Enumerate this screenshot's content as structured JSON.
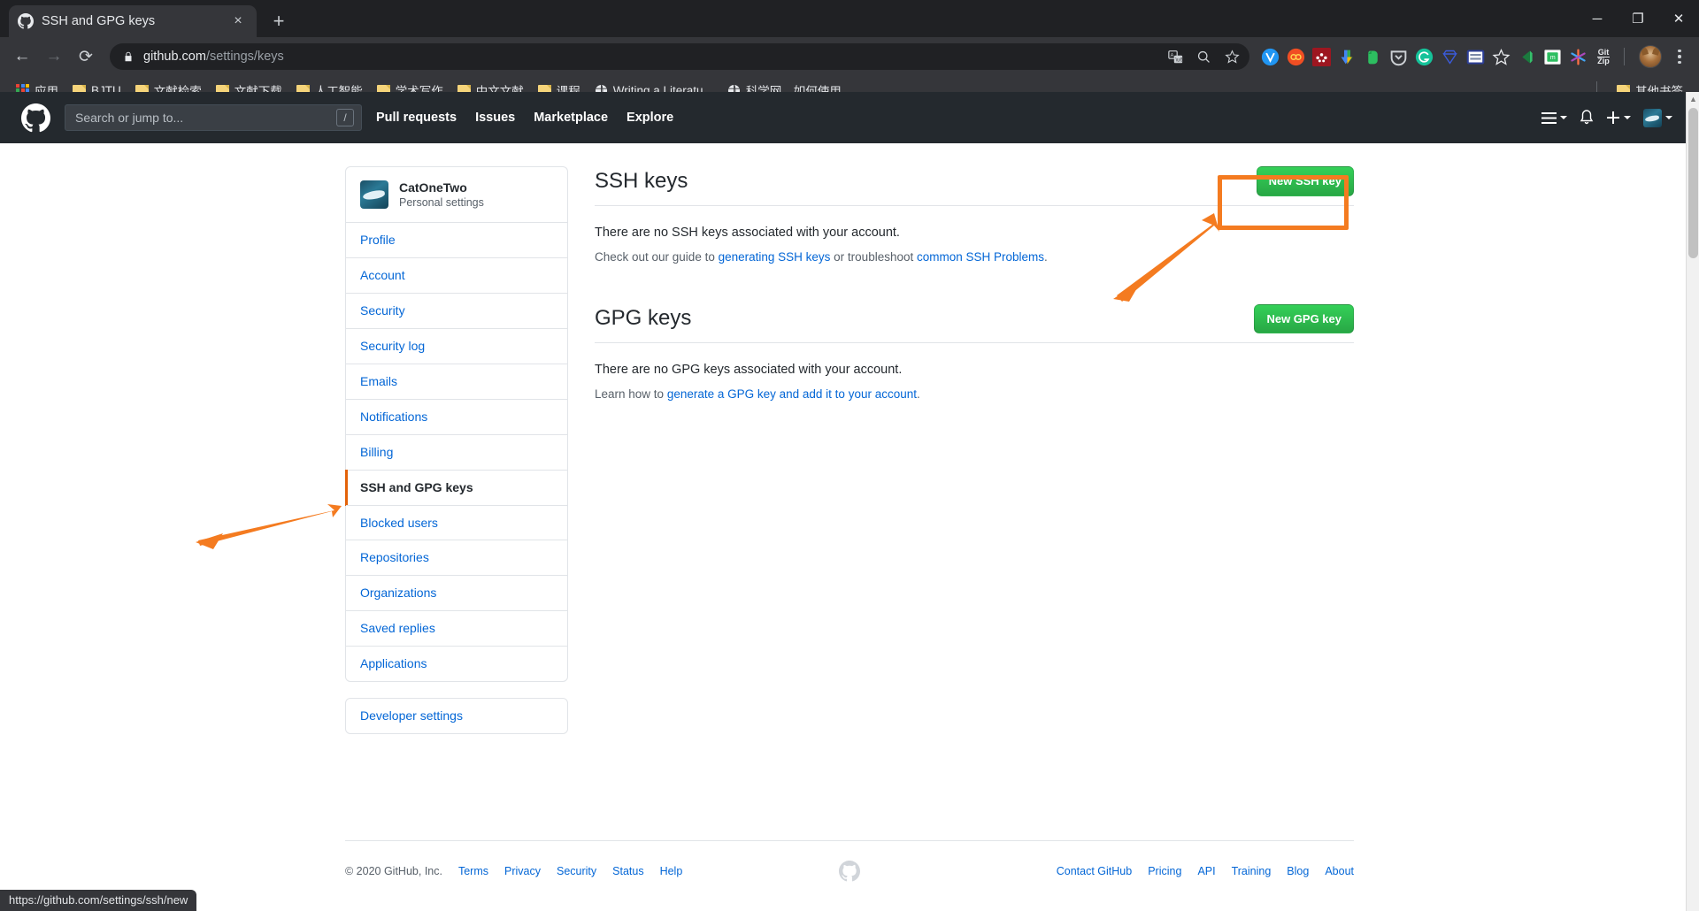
{
  "browser": {
    "tab": {
      "title": "SSH and GPG keys",
      "favicon": "github-icon",
      "close": "×"
    },
    "new_tab_label": "+",
    "window_controls": {
      "minimize": "─",
      "maximize": "❐",
      "close": "✕"
    },
    "nav": {
      "back": "←",
      "forward": "→",
      "reload": "⟳"
    },
    "omnibox": {
      "url_domain": "github.com",
      "url_path": "/settings/keys",
      "lock": "lock-icon"
    },
    "omnibox_icons": [
      "translate-icon",
      "search-icon",
      "bookmark-star-icon"
    ],
    "extensions": [
      "vimium-extension-icon",
      "infinity-extension-icon",
      "mendeley-extension-icon",
      "download-extension-icon",
      "evernote-extension-icon",
      "pocket-extension-icon",
      "grammarly-extension-icon",
      "diamond-extension-icon",
      "reader-extension-icon",
      "star-extension-icon",
      "green-triangle-extension-icon",
      "green-square-extension-icon",
      "asterisk-extension-icon",
      "gitzip-extension-icon"
    ],
    "gitzip_label_top": "Git",
    "gitzip_label_bottom": "Zip",
    "bookmarks": [
      {
        "label": "应用",
        "icon": "apps-grid-icon"
      },
      {
        "label": "BJTU",
        "icon": "folder-icon"
      },
      {
        "label": "文献检索",
        "icon": "folder-icon"
      },
      {
        "label": "文献下载",
        "icon": "folder-icon"
      },
      {
        "label": "人工智能",
        "icon": "folder-icon"
      },
      {
        "label": "学术写作",
        "icon": "folder-icon"
      },
      {
        "label": "中文文献",
        "icon": "folder-icon"
      },
      {
        "label": "课程",
        "icon": "folder-icon"
      },
      {
        "label": "Writing a Literatu...",
        "icon": "globe-icon"
      },
      {
        "label": "科学网—如何使用...",
        "icon": "globe-icon"
      }
    ],
    "other_bookmarks": {
      "label": "其他书签",
      "icon": "folder-icon"
    },
    "status_bar_url": "https://github.com/settings/ssh/new"
  },
  "github": {
    "header": {
      "logo": "github-mark-icon",
      "search_placeholder": "Search or jump to...",
      "search_shortcut": "/",
      "nav": [
        {
          "label": "Pull requests"
        },
        {
          "label": "Issues"
        },
        {
          "label": "Marketplace"
        },
        {
          "label": "Explore"
        }
      ],
      "right_icons": [
        "hamburger-menu-icon",
        "notifications-bell-icon",
        "plus-icon",
        "user-avatar"
      ]
    },
    "sidebar": {
      "account_name": "CatOneTwo",
      "account_subtitle": "Personal settings",
      "items": [
        {
          "label": "Profile",
          "active": false
        },
        {
          "label": "Account",
          "active": false
        },
        {
          "label": "Security",
          "active": false
        },
        {
          "label": "Security log",
          "active": false
        },
        {
          "label": "Emails",
          "active": false
        },
        {
          "label": "Notifications",
          "active": false
        },
        {
          "label": "Billing",
          "active": false
        },
        {
          "label": "SSH and GPG keys",
          "active": true
        },
        {
          "label": "Blocked users",
          "active": false
        },
        {
          "label": "Repositories",
          "active": false
        },
        {
          "label": "Organizations",
          "active": false
        },
        {
          "label": "Saved replies",
          "active": false
        },
        {
          "label": "Applications",
          "active": false
        }
      ],
      "developer_settings": "Developer settings"
    },
    "ssh_section": {
      "title": "SSH keys",
      "button": "New SSH key",
      "empty_message": "There are no SSH keys associated with your account.",
      "help_prefix": "Check out our guide to ",
      "help_link1": "generating SSH keys",
      "help_middle": " or troubleshoot ",
      "help_link2": "common SSH Problems",
      "help_suffix": "."
    },
    "gpg_section": {
      "title": "GPG keys",
      "button": "New GPG key",
      "empty_message": "There are no GPG keys associated with your account.",
      "help_prefix": "Learn how to ",
      "help_link1": "generate a GPG key and add it to your account",
      "help_suffix": "."
    },
    "footer": {
      "copyright": "© 2020 GitHub, Inc.",
      "left_links": [
        "Terms",
        "Privacy",
        "Security",
        "Status",
        "Help"
      ],
      "right_links": [
        "Contact GitHub",
        "Pricing",
        "API",
        "Training",
        "Blog",
        "About"
      ],
      "logo": "github-mark-icon"
    }
  },
  "annotations": {
    "accent_color": "#f47b20",
    "highlight_target": "New SSH key button",
    "arrow_to_sidebar_target": "SSH and GPG keys sidebar item"
  },
  "colors": {
    "chrome_dark": "#35363a",
    "chrome_darker": "#202124",
    "github_header": "#24292e",
    "link_blue": "#0366d6",
    "green_button": "#28a745",
    "active_orange": "#e36209",
    "annotation_orange": "#f47b20"
  }
}
